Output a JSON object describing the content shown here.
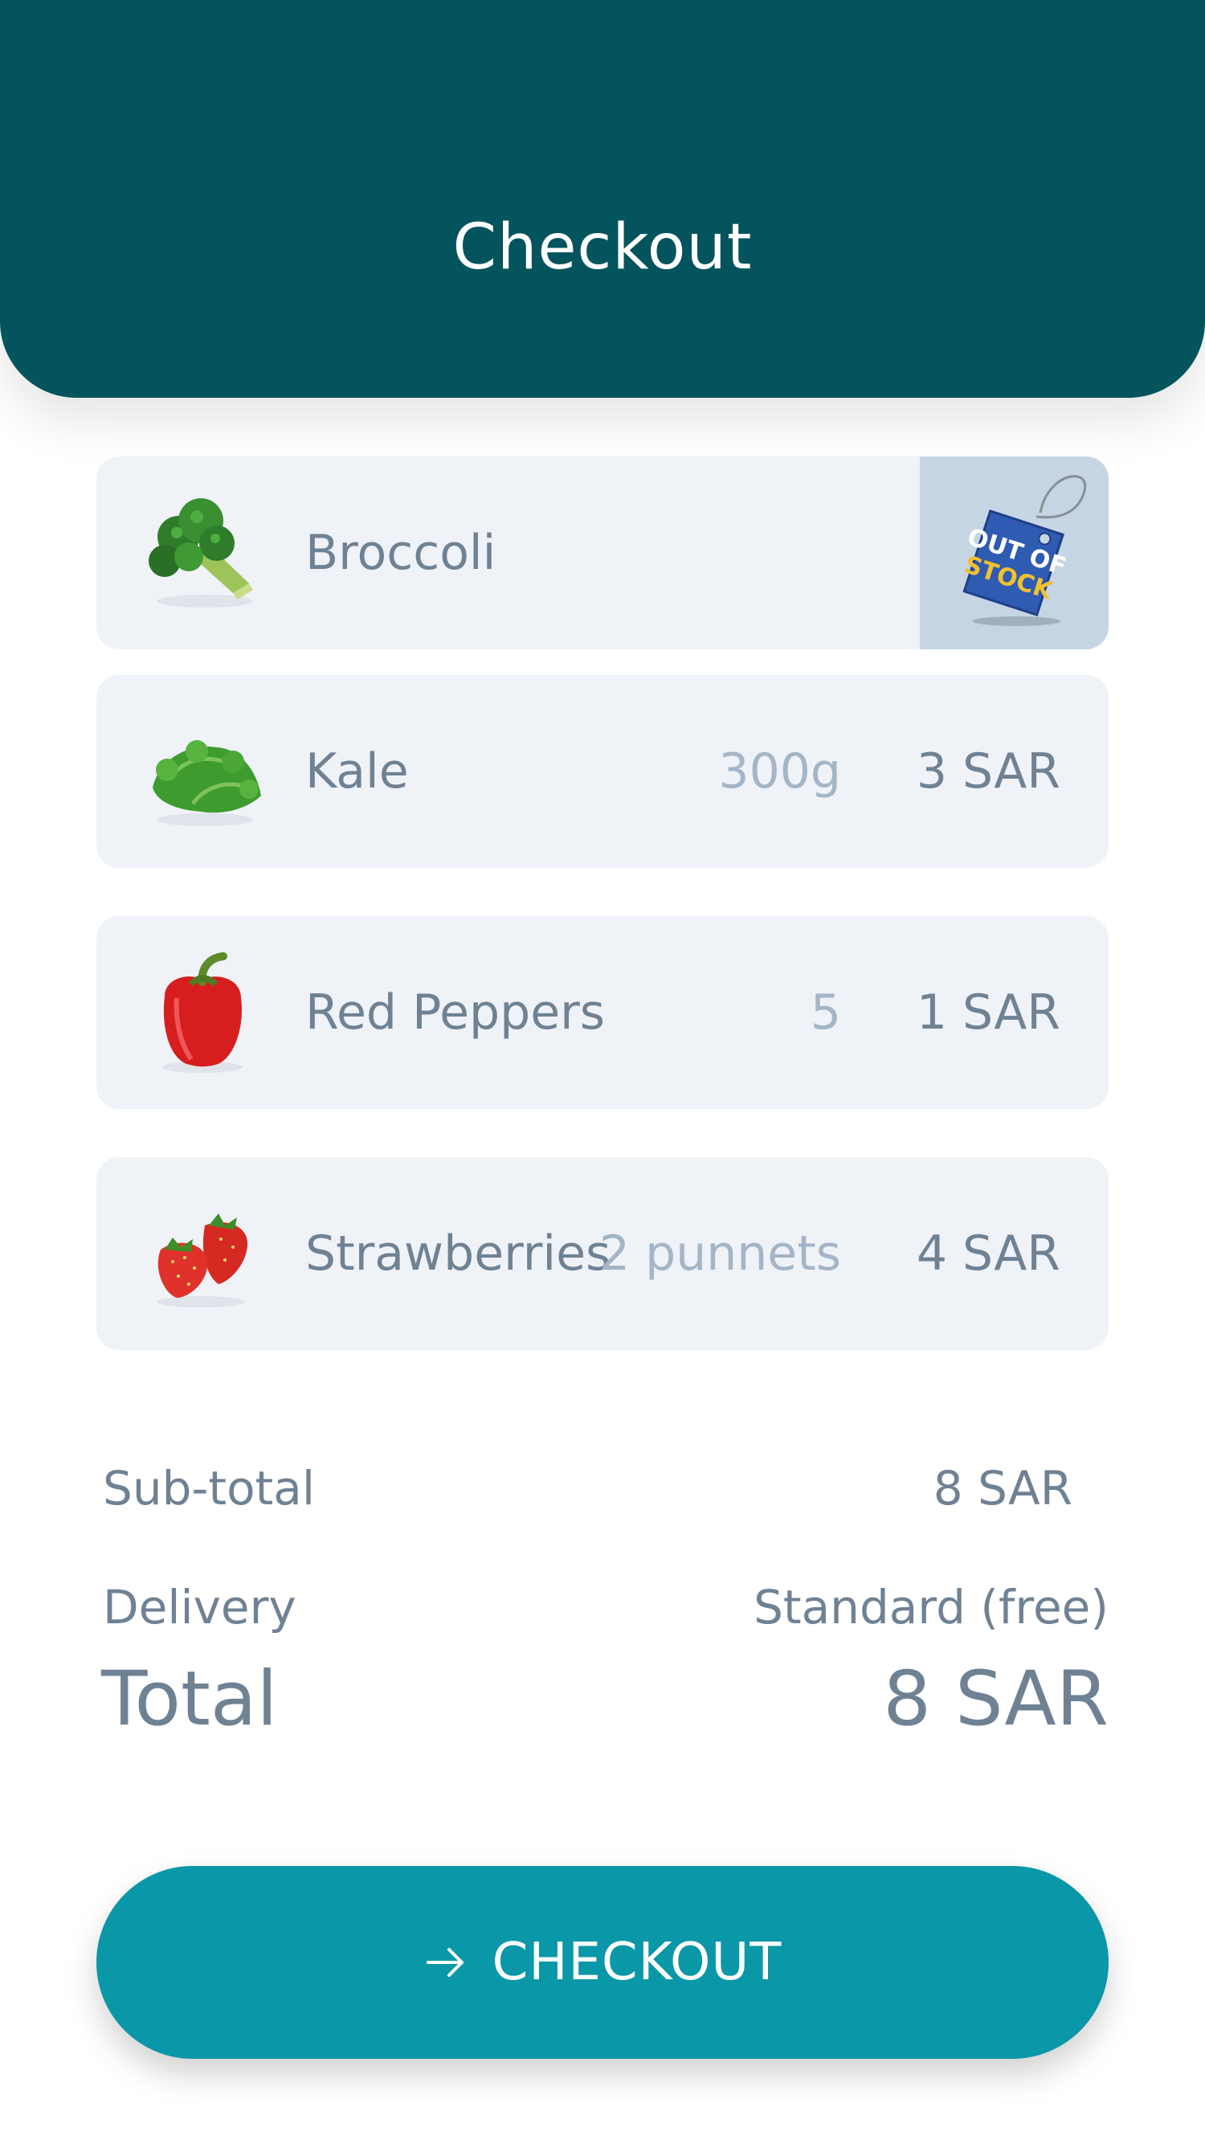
{
  "header": {
    "title": "Checkout"
  },
  "items": [
    {
      "name": "Broccoli",
      "qty": "",
      "price": "",
      "status": "OUT OF STOCK",
      "icon": "broccoli-icon"
    },
    {
      "name": "Kale",
      "qty": "300g",
      "price": "3 SAR",
      "icon": "kale-icon"
    },
    {
      "name": "Red Peppers",
      "qty": "5",
      "price": "1 SAR",
      "icon": "red-pepper-icon"
    },
    {
      "name": "Strawberries",
      "qty": "2 punnets",
      "price": "4 SAR",
      "icon": "strawberry-icon"
    }
  ],
  "out_of_stock_badge": {
    "line1": "OUT OF",
    "line2": "STOCK"
  },
  "summary": {
    "subtotal_label": "Sub-total",
    "subtotal_value": "8 SAR",
    "delivery_label": "Delivery",
    "delivery_value": "Standard (free)",
    "total_label": "Total",
    "total_value": "8 SAR"
  },
  "checkout_button": {
    "label": "CHECKOUT",
    "icon": "arrow-right-icon"
  },
  "colors": {
    "header_bg": "#03545d",
    "card_bg": "#eff2f7",
    "text": "#6f8294",
    "muted_text": "#a3b5c7",
    "button_bg": "#0a97a7"
  }
}
